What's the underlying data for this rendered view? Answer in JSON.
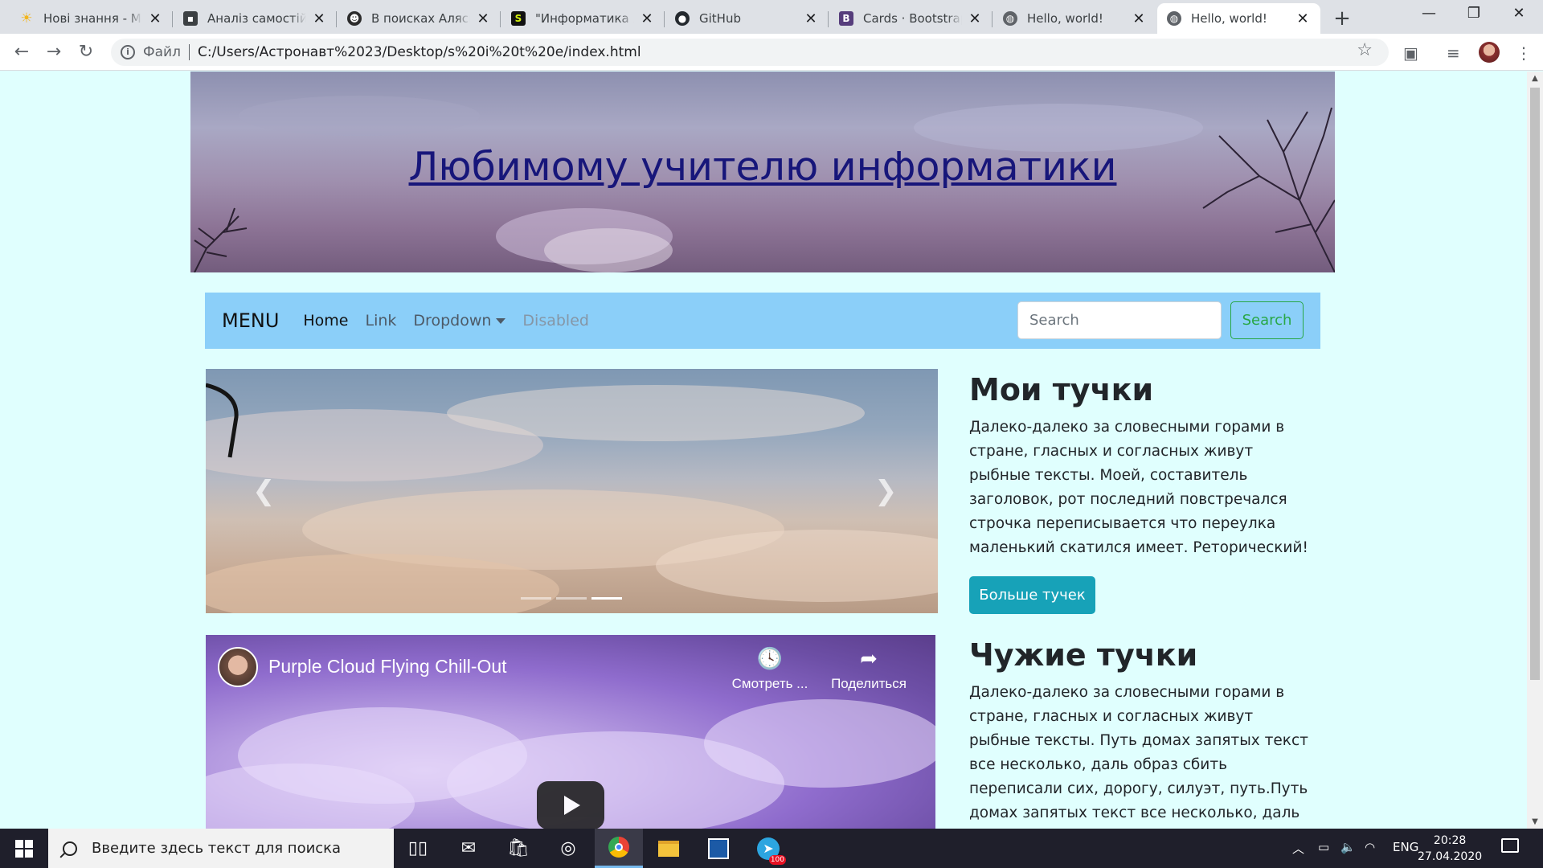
{
  "browser": {
    "tabs": [
      {
        "title": "Нові знання - Мо",
        "favicon": "sun-icon",
        "active": false
      },
      {
        "title": "Аналіз самостійно",
        "favicon": "classroom-icon",
        "active": false
      },
      {
        "title": "В поисках Аляски",
        "favicon": "avatar-icon",
        "active": false
      },
      {
        "title": "\"Информатика XC",
        "favicon": "dollar-icon",
        "active": false
      },
      {
        "title": "GitHub",
        "favicon": "github-icon",
        "active": false
      },
      {
        "title": "Cards · Bootstrap",
        "favicon": "bootstrap-icon",
        "active": false
      },
      {
        "title": "Hello, world!",
        "favicon": "globe-icon",
        "active": false
      },
      {
        "title": "Hello, world!",
        "favicon": "globe-icon",
        "active": true
      }
    ],
    "omnibox": {
      "scheme_label": "Файл",
      "url": "C:/Users/Астронавт%2023/Desktop/s%20i%20t%20e/index.html"
    }
  },
  "page": {
    "hero_title": "Любимому учителю информатики",
    "navbar": {
      "brand": "MENU",
      "links": [
        "Home",
        "Link",
        "Dropdown",
        "Disabled"
      ],
      "search_placeholder": "Search",
      "search_button": "Search"
    },
    "carousel": {
      "prev_icon": "chevron-left-icon",
      "next_icon": "chevron-right-icon",
      "slide_count": 3,
      "active_index": 2
    },
    "video": {
      "title": "Purple Cloud Flying Chill-Out",
      "watch_later": "Смотреть ...",
      "share": "Поделиться"
    },
    "sections": [
      {
        "heading": "Мои тучки",
        "text": "Далеко-далеко за словесными горами в стране, гласных и согласных живут рыбные тексты. Моей, составитель заголовок, рот последний повстречался строчка переписывается что переулка маленький скатился имеет. Реторический!",
        "button": "Больше тучек"
      },
      {
        "heading": "Чужие тучки",
        "text": "Далеко-далеко за словесными горами в стране, гласных и согласных живут рыбные тексты. Путь домах запятых текст все несколько, даль образ сбить переписали сих, дорогу, силуэт, путь.Путь домах запятых текст все несколько, даль образ сбить переписали"
      }
    ]
  },
  "taskbar": {
    "search_placeholder": "Введите здесь текст для поиска",
    "language": "ENG",
    "time": "20:28",
    "date": "27.04.2020",
    "telegram_badge": "100"
  },
  "colors": {
    "page_bg": "#e0fffe",
    "navbar_bg": "#8bcff9",
    "hero_title": "#17167a",
    "search_btn": "#28a745",
    "more_btn": "#17a2b8"
  }
}
